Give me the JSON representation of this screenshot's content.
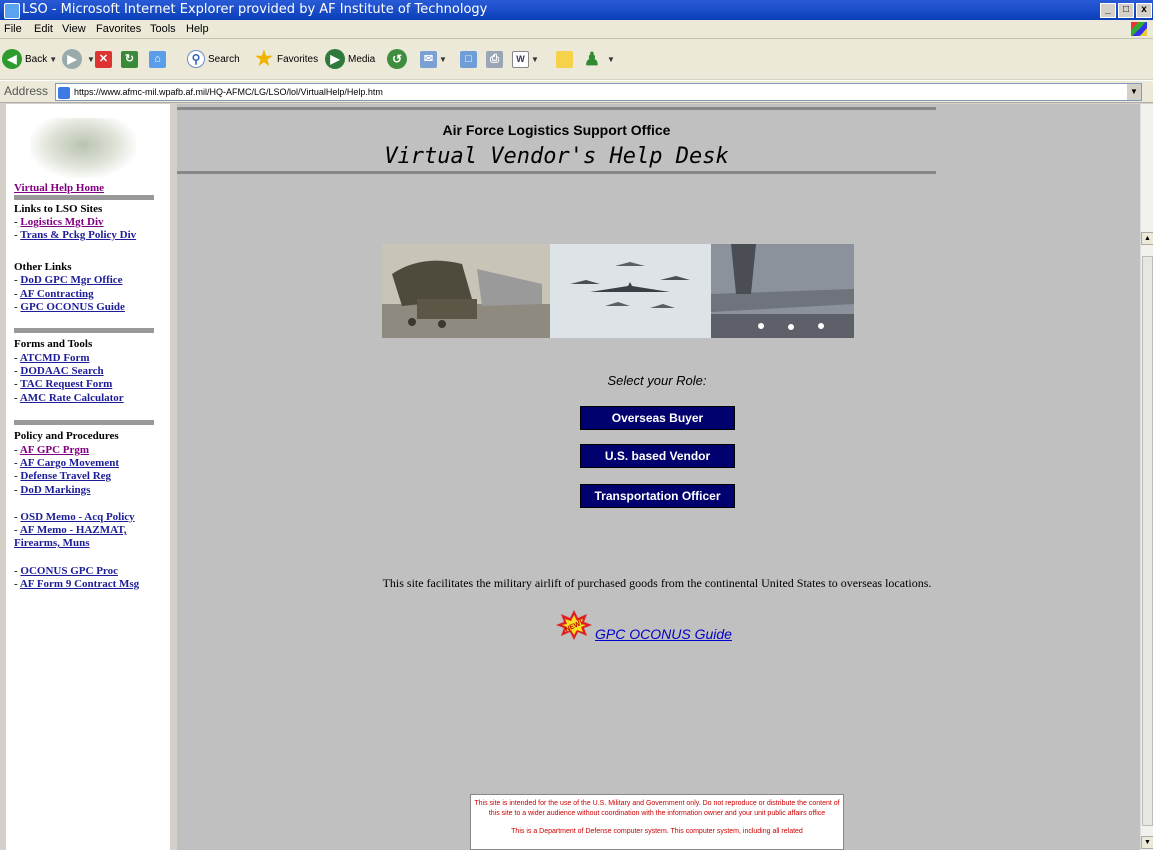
{
  "window": {
    "title": "LSO - Microsoft Internet Explorer provided by AF Institute of Technology",
    "min": "_",
    "max": "□",
    "close": "x"
  },
  "menu": [
    "File",
    "Edit",
    "View",
    "Favorites",
    "Tools",
    "Help"
  ],
  "toolbar": {
    "back": "Back",
    "search": "Search",
    "favorites": "Favorites",
    "media": "Media"
  },
  "address": {
    "label": "Address",
    "url": "https://www.afmc-mil.wpafb.af.mil/HQ-AFMC/LG/LSO/lol/VirtualHelp/Help.htm"
  },
  "nav": {
    "home": "Virtual Help Home",
    "lso_header": "Links to LSO Sites",
    "lso_links": [
      "Logistics Mgt Div",
      "Trans & Pckg Policy Div"
    ],
    "other_header": "Other Links",
    "other_links": [
      "DoD GPC Mgr Office",
      "AF Contracting",
      "GPC OCONUS Guide"
    ],
    "forms_header": "Forms and Tools",
    "forms_links": [
      "ATCMD Form",
      "DODAAC Search",
      "TAC Request Form",
      "AMC Rate Calculator"
    ],
    "policy_header": "Policy and Procedures",
    "policy_links": [
      "AF GPC Prgm",
      "AF Cargo Movement",
      "Defense Travel Reg",
      "DoD Markings"
    ],
    "memo_links": [
      "OSD Memo - Acq Policy",
      "AF Memo - HAZMAT,",
      "Firearms, Muns"
    ],
    "oconus_links": [
      "OCONUS GPC Proc",
      "AF Form 9 Contract Msg"
    ],
    "dash": "-"
  },
  "main": {
    "org": "Air Force Logistics Support Office",
    "subtitle": "Virtual Vendor's Help Desk",
    "role_prompt": "Select your Role:",
    "roles": [
      "Overseas Buyer",
      "U.S. based Vendor",
      "Transportation Officer"
    ],
    "description": "This site facilitates the military airlift of purchased goods from the continental United States to overseas locations.",
    "new_badge": "NEW!",
    "guide_link": "GPC OCONUS Guide",
    "notice_1": "This site is intended for the use of the U.S. Military and Government only. Do not reproduce or distribute the content of this site to a wider audience without coordination with the information owner and your unit public affairs office",
    "notice_2": "This is a Department of Defense computer system. This computer system, including all related"
  }
}
